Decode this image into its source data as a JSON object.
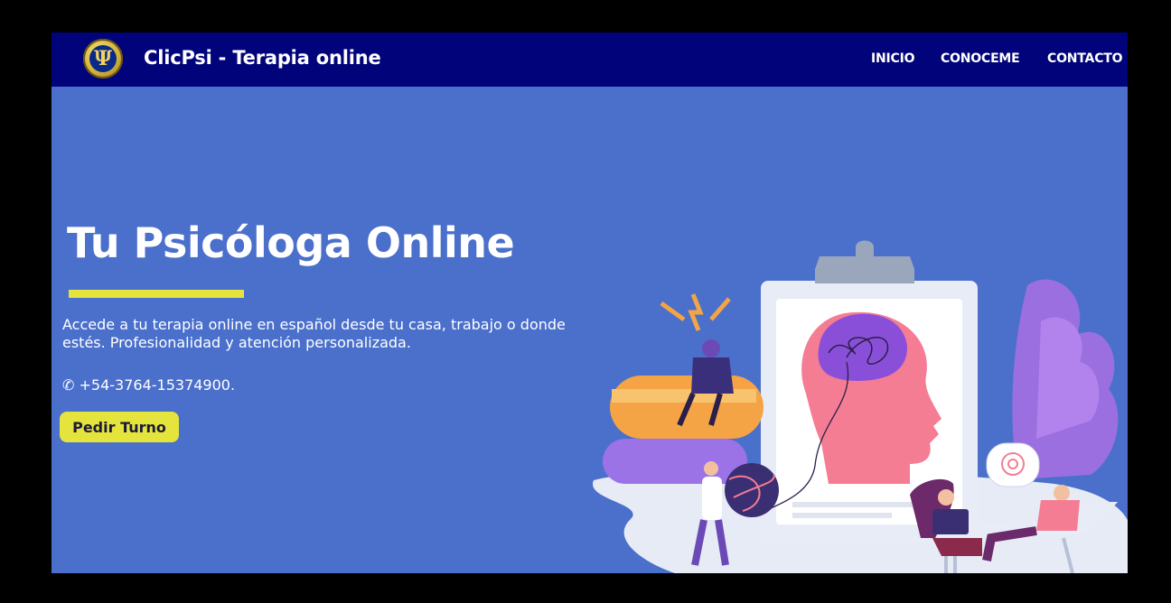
{
  "navbar": {
    "logo_symbol": "Ψ",
    "brand": "ClicPsi - Terapia online",
    "links": [
      "INICIO",
      "CONOCEME",
      "CONTACTO"
    ]
  },
  "hero": {
    "title": "Tu Psicóloga Online",
    "description": "Accede a tu terapia online en español desde tu casa, trabajo o donde estés. Profesionalidad y atención personalizada.",
    "phone": "✆ +54-3764-15374900.",
    "cta_label": "Pedir Turno"
  },
  "colors": {
    "navbar_bg": "#01037a",
    "hero_bg": "#4a70cc",
    "accent_yellow": "#e5e43c"
  },
  "icons": [
    "psi-logo-icon",
    "phone-icon",
    "therapy-illustration"
  ]
}
